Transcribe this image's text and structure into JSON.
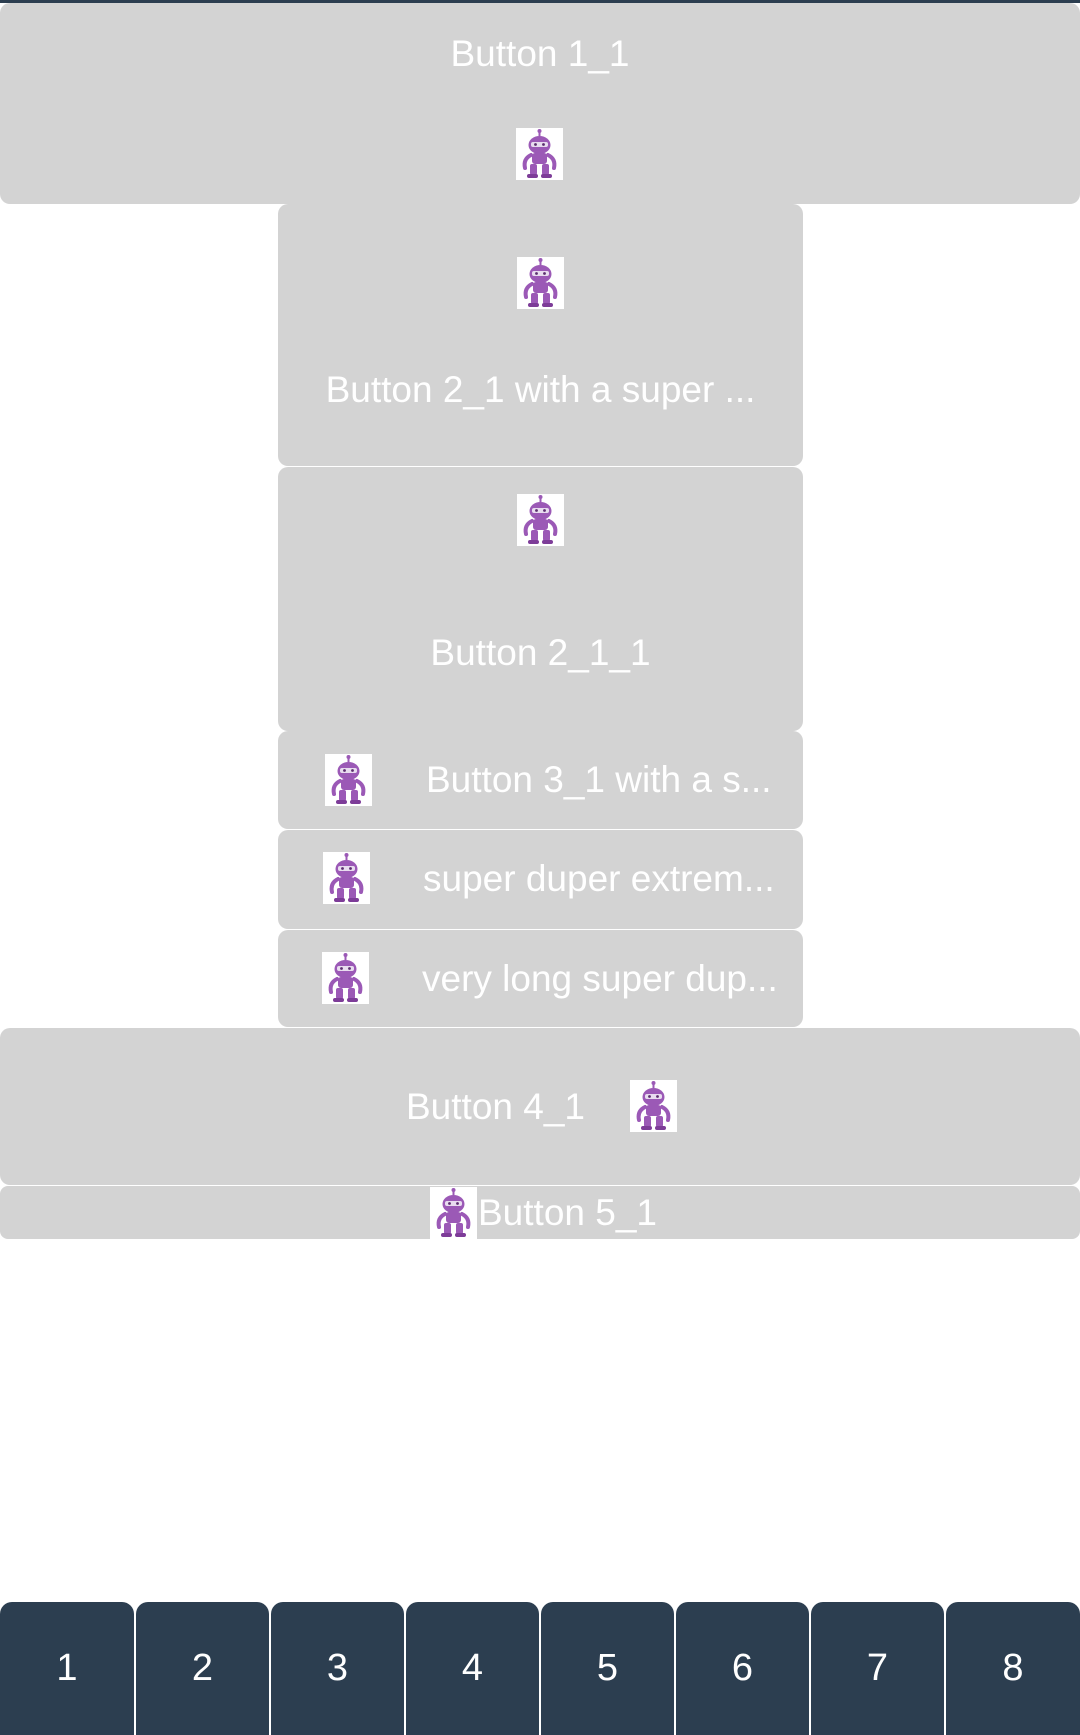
{
  "buttons": {
    "b1": {
      "label": "Button 1_1",
      "icon": "robot-icon"
    },
    "b2": {
      "label": "Button 2_1 with a super ...",
      "icon": "robot-icon"
    },
    "b3": {
      "label": "Button 2_1_1",
      "icon": "robot-icon"
    },
    "b4": {
      "label": "Button 3_1 with a s...",
      "icon": "robot-icon"
    },
    "b5": {
      "label": "super duper extrem...",
      "icon": "robot-icon"
    },
    "b6": {
      "label": "very long super dup...",
      "icon": "robot-icon"
    },
    "b7": {
      "label": "Button 4_1",
      "icon": "robot-icon"
    },
    "b8": {
      "label": "Button 5_1",
      "icon": "robot-icon"
    }
  },
  "tabs": [
    {
      "label": "1"
    },
    {
      "label": "2"
    },
    {
      "label": "3"
    },
    {
      "label": "4"
    },
    {
      "label": "5"
    },
    {
      "label": "6"
    },
    {
      "label": "7"
    },
    {
      "label": "8"
    }
  ],
  "colors": {
    "button_bg": "#d3d3d3",
    "tabbar_bg": "#2c3e50",
    "icon_purple": "#9b59b6"
  }
}
